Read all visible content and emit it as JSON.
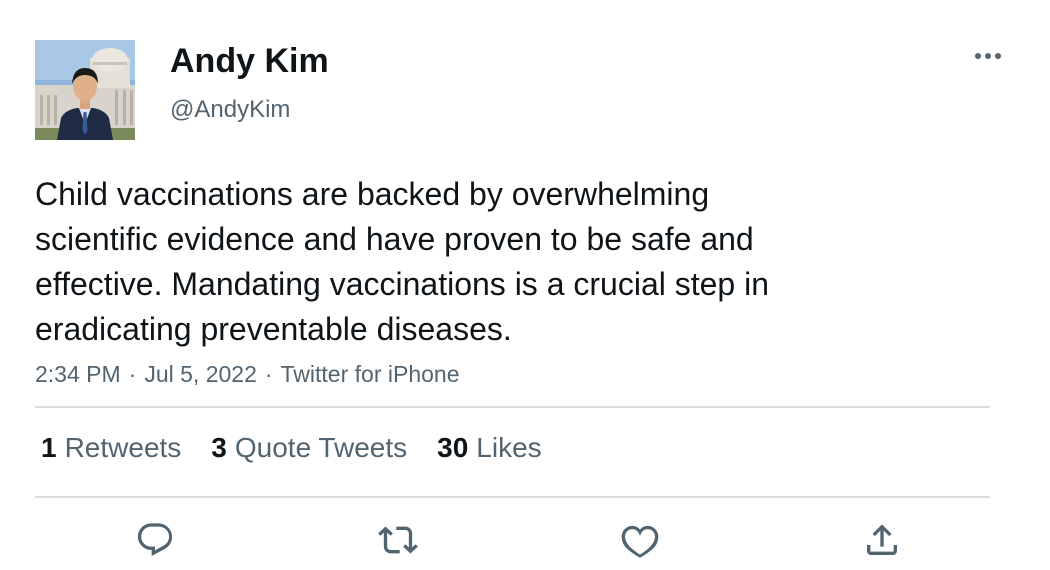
{
  "author": {
    "display_name": "Andy Kim",
    "handle": "@AndyKim"
  },
  "tweet": {
    "text_lines": [
      "Child vaccinations are backed by overwhelming",
      "scientific evidence and have proven to be safe and",
      "effective. Mandating vaccinations is a crucial step in",
      "eradicating preventable diseases."
    ],
    "time": "2:34 PM",
    "date": "Jul 5, 2022",
    "source": "Twitter for iPhone",
    "separator": "·"
  },
  "stats": {
    "retweets": {
      "count": "1",
      "label": "Retweets"
    },
    "quote_tweets": {
      "count": "3",
      "label": "Quote Tweets"
    },
    "likes": {
      "count": "30",
      "label": "Likes"
    }
  },
  "icons": {
    "more": "more-horizontal-icon",
    "reply": "reply-icon",
    "retweet": "retweet-icon",
    "like": "heart-icon",
    "share": "share-icon"
  },
  "colors": {
    "text_primary": "#0f1419",
    "text_secondary": "#536471",
    "divider": "#d9dde1",
    "icon": "#536471"
  }
}
